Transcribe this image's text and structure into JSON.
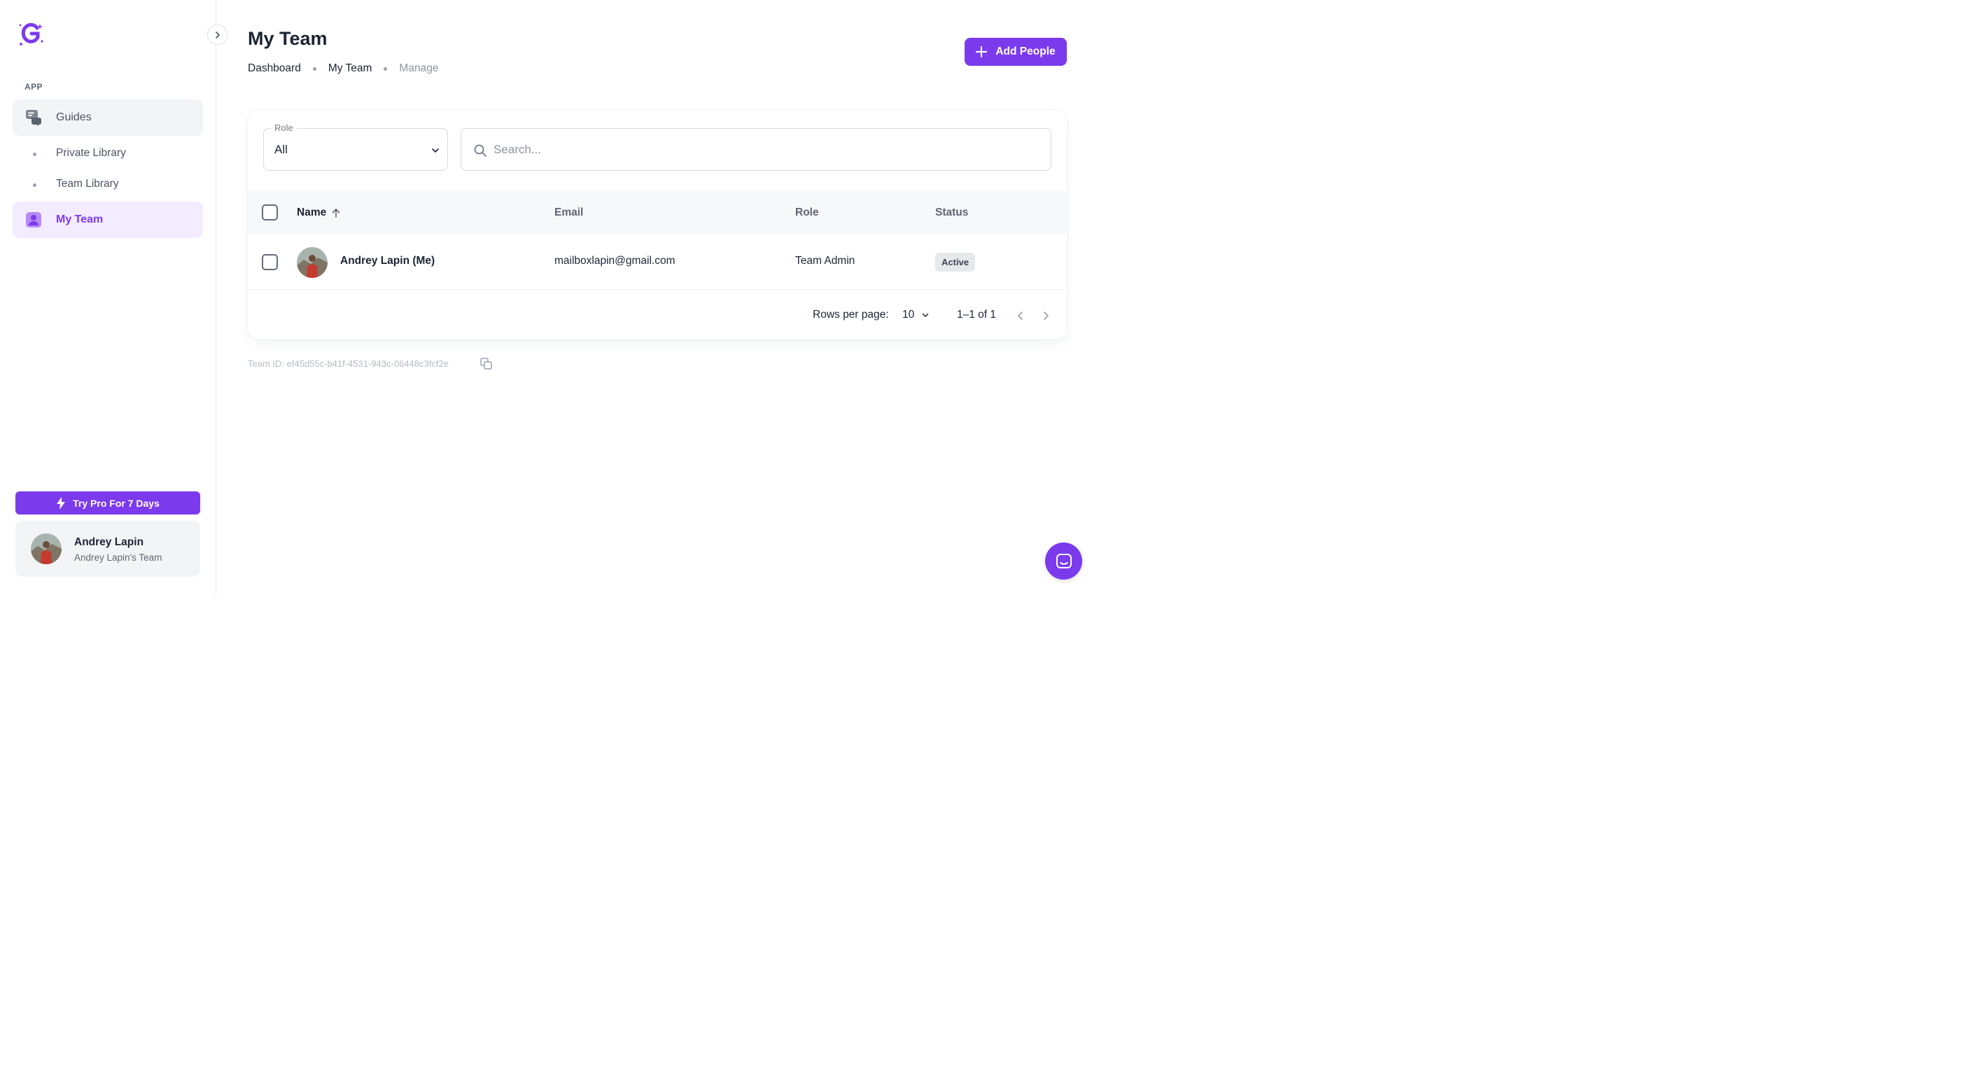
{
  "colors": {
    "accent": "#7c3aed",
    "nav_active_bg": "#f3ebff",
    "badge_bg": "#e6e9ec"
  },
  "sidebar": {
    "logo_icon": "sparkle-g-logo-icon",
    "section_label": "APP",
    "items": [
      {
        "label": "Guides",
        "icon": "chat-bubbles-icon"
      },
      {
        "label": "Private Library"
      },
      {
        "label": "Team Library"
      },
      {
        "label": "My Team",
        "icon": "user-icon",
        "active": true
      }
    ],
    "pro_button": "Try Pro For 7 Days",
    "user": {
      "name": "Andrey Lapin",
      "team": "Andrey Lapin's Team"
    }
  },
  "header": {
    "title": "My Team",
    "breadcrumb": [
      "Dashboard",
      "My Team",
      "Manage"
    ],
    "add_button": "Add People"
  },
  "filters": {
    "role_label": "Role",
    "role_value": "All",
    "search_placeholder": "Search..."
  },
  "table": {
    "columns": [
      "Name",
      "Email",
      "Role",
      "Status"
    ],
    "sort": {
      "column": "Name",
      "direction": "asc"
    },
    "rows": [
      {
        "name": "Andrey Lapin (Me)",
        "email": "mailboxlapin@gmail.com",
        "role": "Team Admin",
        "status": "Active"
      }
    ]
  },
  "pagination": {
    "rows_per_page_label": "Rows per page:",
    "rows_per_page": "10",
    "range": "1–1 of 1"
  },
  "team_id": "Team ID: ef45d55c-b41f-4531-943c-06448c3fcf2e"
}
